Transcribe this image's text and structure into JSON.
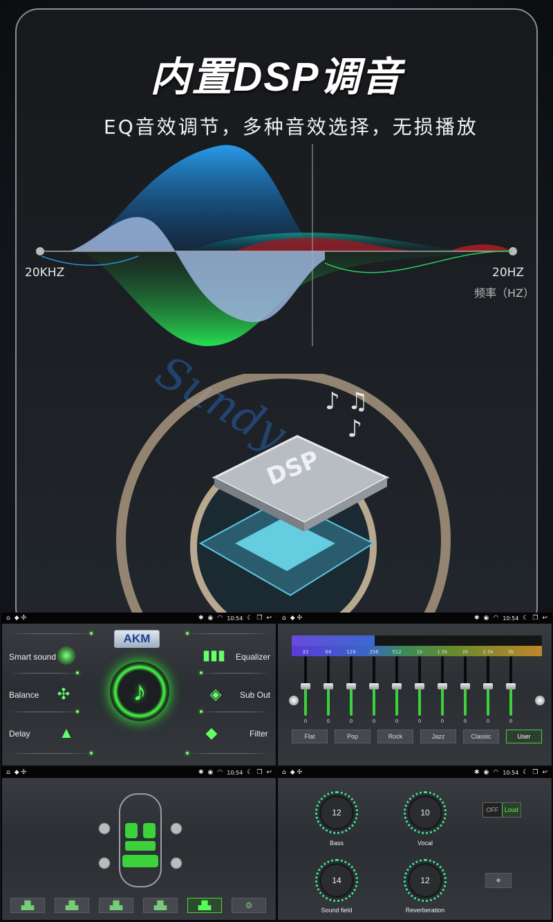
{
  "hero": {
    "headline": "内置DSP调音",
    "subline": "EQ音效调节，多种音效选择，无损播放",
    "left_label": "20KHZ",
    "right_label": "20HZ",
    "axis_unit": "频率（HZ）",
    "watermark": "Sundy",
    "chip_label": "DSP"
  },
  "status": {
    "time": "10:54"
  },
  "menu_panel": {
    "brand": "AKM",
    "left_items": [
      "Smart sound",
      "Balance",
      "Delay"
    ],
    "right_items": [
      "Equalizer",
      "Sub Out",
      "Filter"
    ]
  },
  "eq_panel": {
    "bands": [
      "32",
      "64",
      "128",
      "256",
      "512",
      "1k",
      "1.5k",
      "2k",
      "2.5k",
      "3k"
    ],
    "values": [
      "0",
      "0",
      "0",
      "0",
      "0",
      "0",
      "0",
      "0",
      "0",
      "0"
    ],
    "levels": [
      0.5,
      0.5,
      0.5,
      0.5,
      0.5,
      0.5,
      0.5,
      0.5,
      0.5,
      0.5
    ],
    "presets": [
      "Flat",
      "Pop",
      "Rock",
      "Jazz",
      "Classic",
      "User"
    ],
    "active_preset": "User"
  },
  "balance_panel": {
    "buttons": [
      "seat-front-left",
      "seat-front-right",
      "seat-rear-left",
      "seat-rear-right",
      "seat-all",
      "user-settings"
    ],
    "active_index": 4
  },
  "knob_panel": {
    "knobs": [
      {
        "label": "Bass",
        "value": "12"
      },
      {
        "label": "Vocal",
        "value": "10"
      },
      {
        "label": "Sound field",
        "value": "14"
      },
      {
        "label": "Reverberation",
        "value": "12"
      }
    ],
    "loud_off": "OFF",
    "loud_on": "Loud"
  },
  "colors": {
    "accent_green": "#3bd23b",
    "knob_ring": "#40e08a",
    "eq_blue": "#2a8fd0",
    "eq_red": "#c0202a"
  }
}
